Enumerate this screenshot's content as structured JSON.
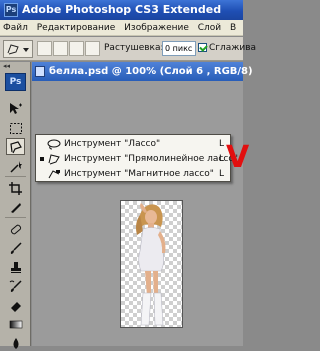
{
  "window": {
    "badge": "Ps",
    "title": "Adobe Photoshop CS3 Extended"
  },
  "menu": [
    "Файл",
    "Редактирование",
    "Изображение",
    "Слой",
    "В"
  ],
  "options": {
    "feather_label": "Растушевка:",
    "feather_value": "0 пикс",
    "antialias_label": "Сглажива",
    "antialias_checked": true
  },
  "toolbox": {
    "logo": "Ps",
    "collapse_arrows": "◂◂",
    "tools": [
      {
        "name": "move-icon"
      },
      {
        "name": "marquee-icon"
      },
      {
        "name": "lasso-icon",
        "active": true
      },
      {
        "name": "magic-wand-icon"
      },
      {
        "name": "crop-icon"
      },
      {
        "name": "slice-icon"
      },
      {
        "name": "healing-brush-icon"
      },
      {
        "name": "brush-icon"
      },
      {
        "name": "clone-stamp-icon"
      },
      {
        "name": "history-brush-icon"
      },
      {
        "name": "eraser-icon"
      },
      {
        "name": "gradient-icon"
      },
      {
        "name": "blur-icon"
      },
      {
        "name": "dodge-icon"
      }
    ]
  },
  "document": {
    "title": "белла.psd @ 100% (Слой 6 , RGB/8)"
  },
  "flyout": {
    "items": [
      {
        "label": "Инструмент \"Лассо\"",
        "key": "L",
        "icon": "lasso-icon",
        "selected": false
      },
      {
        "label": "Инструмент \"Прямолинейное лассо\"",
        "key": "L",
        "icon": "polygonal-lasso-icon",
        "selected": true
      },
      {
        "label": "Инструмент \"Магнитное лассо\"",
        "key": "L",
        "icon": "magnetic-lasso-icon",
        "selected": false
      }
    ]
  },
  "annotation": {
    "mark": "V",
    "color": "#e20f0f"
  },
  "colors": {
    "title_bar": "#1f4fb4",
    "doc_tab": "#285db8",
    "workspace": "#9b9b9b",
    "toolbox": "#b5b2a9"
  }
}
